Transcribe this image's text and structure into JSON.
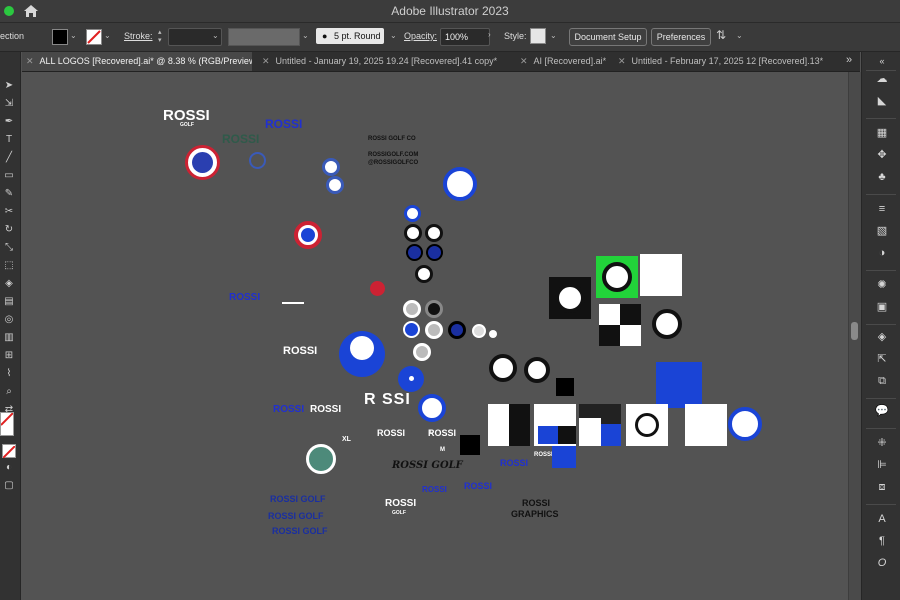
{
  "window": {
    "title": "Adobe Illustrator 2023",
    "accent_green": "#2bc840"
  },
  "control_bar": {
    "selection_label": "ection",
    "stroke_label": "Stroke:",
    "brush_value": "5 pt. Round",
    "opacity_label": "Opacity:",
    "opacity_value": "100%",
    "style_label": "Style:",
    "document_setup_label": "Document Setup",
    "preferences_label": "Preferences"
  },
  "tabs": [
    {
      "label": "ALL LOGOS [Recovered].ai* @ 8.38 % (RGB/Preview)",
      "active": true
    },
    {
      "label": "Untitled - January 19, 2025 19.24 [Recovered].41 copy*",
      "active": false
    },
    {
      "label": "AI [Recovered].ai*",
      "active": false
    },
    {
      "label": "Untitled - February 17, 2025 12 [Recovered].13*",
      "active": false
    }
  ],
  "tab_overflow": "»",
  "canvas_text": {
    "rossi": "ROSSI",
    "golf": "GOLF",
    "rossi_golf_co": "ROSSI GOLF CO",
    "rossigolf_com": "ROSSIGOLF.COM",
    "rossigolfco_handle": "@ROSSIGOLFCO",
    "rossi_golf_1": "ROSSI GOLF",
    "rossi_golf_2": "ROSSI GOLF",
    "rossi_golf_3": "ROSSI GOLF",
    "rossi_script": "ROSSI GOLF",
    "rossi_graphics_1": "ROSSI",
    "rossi_graphics_2": "GRAPHICS",
    "size_xl": "XL",
    "size_l": "L",
    "size_m": "M",
    "rossi_wide": "R SSI"
  },
  "colors": {
    "app_bg": "#535353",
    "panel": "#323232",
    "royal_blue": "#1a44d6",
    "red": "#cc2233",
    "green_card": "#22d33a",
    "teal": "#4d8a7a",
    "dark_green": "#2f5a4a",
    "gold": "#d6a640"
  }
}
